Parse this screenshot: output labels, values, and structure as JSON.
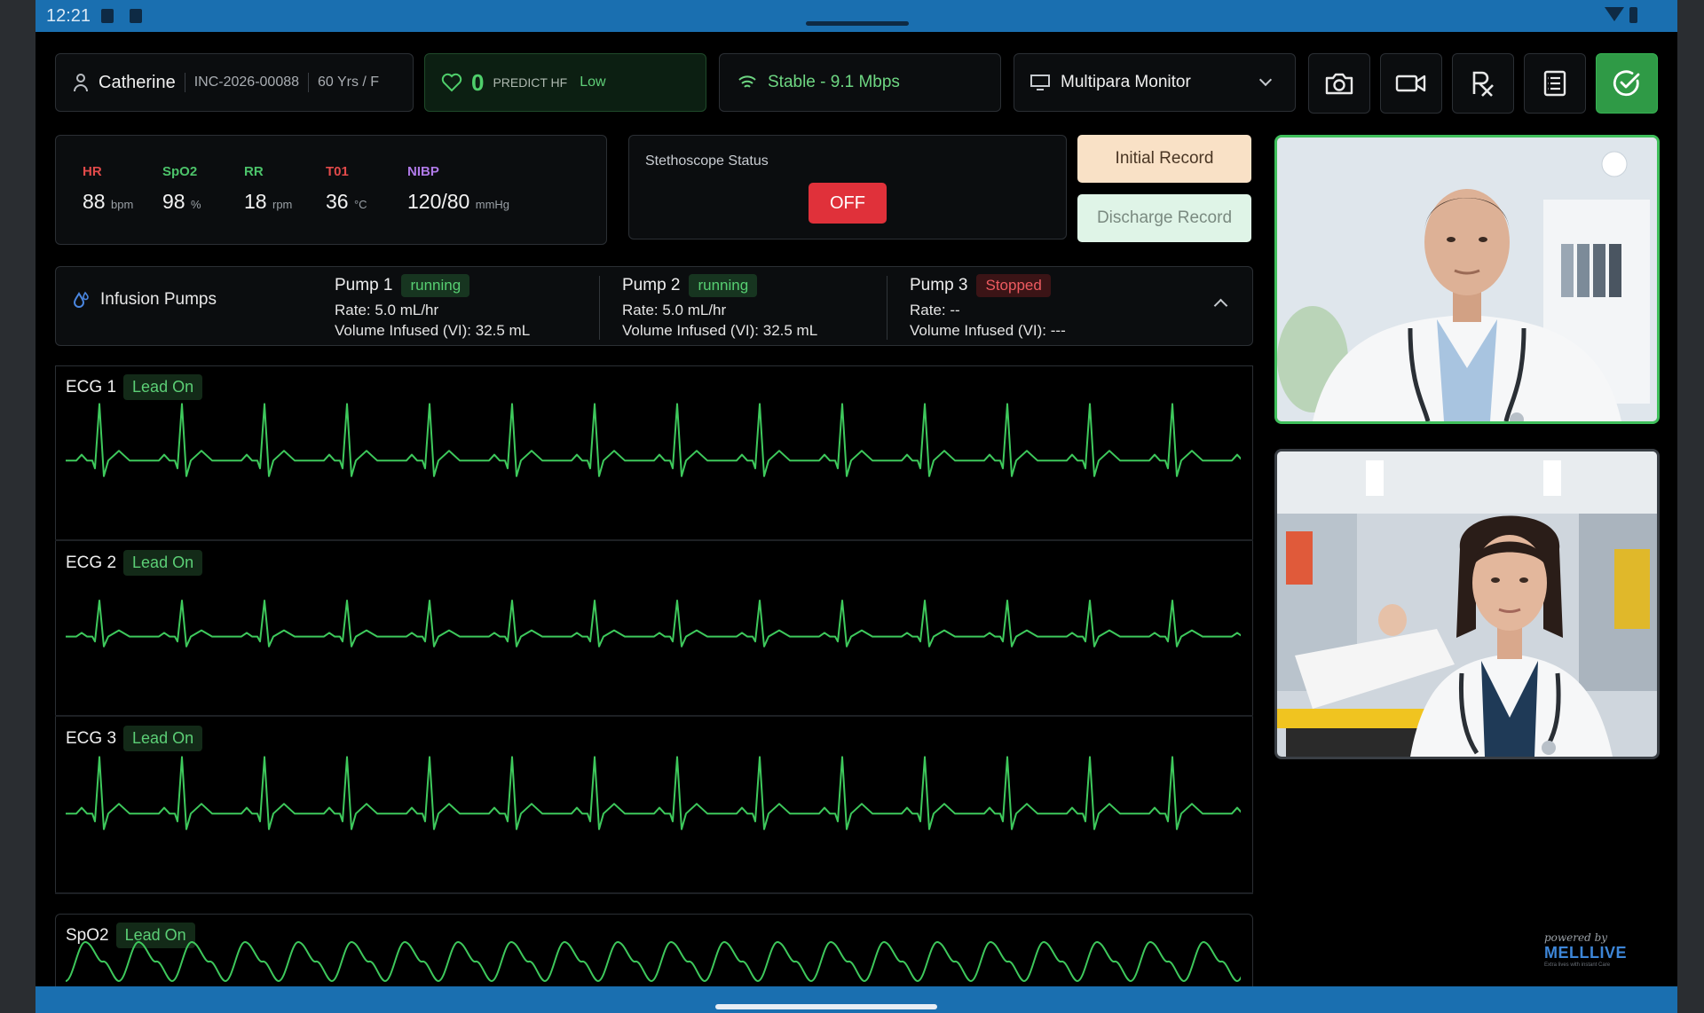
{
  "status_bar": {
    "time": "12:21"
  },
  "patient": {
    "name": "Catherine",
    "incident_id": "INC-2026-00088",
    "age_sex": "60 Yrs / F"
  },
  "predict": {
    "score": "0",
    "label": "PREDICT HF",
    "level": "Low"
  },
  "network": {
    "status": "Stable - 9.1 Mbps",
    "icon": "wifi-icon"
  },
  "monitor_select": {
    "selected": "Multipara Monitor"
  },
  "toolbar": {
    "buttons": [
      "camera-icon",
      "video-icon",
      "prescription-icon",
      "notes-icon",
      "check-circle-icon"
    ]
  },
  "vitals": [
    {
      "label": "HR",
      "value": "88",
      "unit": "bpm",
      "color": "#e24a4a"
    },
    {
      "label": "SpO2",
      "value": "98",
      "unit": "%",
      "color": "#4cc36a"
    },
    {
      "label": "RR",
      "value": "18",
      "unit": "rpm",
      "color": "#4cc36a"
    },
    {
      "label": "T01",
      "value": "36",
      "unit": "°C",
      "color": "#e24a4a"
    },
    {
      "label": "NIBP",
      "value": "120/80",
      "unit": "mmHg",
      "color": "#b07ae8"
    }
  ],
  "stethoscope": {
    "title": "Stethoscope Status",
    "state": "OFF"
  },
  "records": {
    "initial": "Initial Record",
    "discharge": "Discharge Record"
  },
  "infusion": {
    "title": "Infusion Pumps",
    "pumps": [
      {
        "name": "Pump 1",
        "status": "running",
        "rate": "Rate: 5.0 mL/hr",
        "volume": "Volume Infused (VI): 32.5 mL"
      },
      {
        "name": "Pump 2",
        "status": "running",
        "rate": "Rate: 5.0 mL/hr",
        "volume": "Volume Infused (VI): 32.5 mL"
      },
      {
        "name": "Pump 3",
        "status": "Stopped",
        "rate": "Rate: --",
        "volume": "Volume Infused (VI): ---"
      }
    ]
  },
  "waveforms": [
    {
      "name": "ECG 1",
      "lead": "Lead On"
    },
    {
      "name": "ECG 2",
      "lead": "Lead On"
    },
    {
      "name": "ECG 3",
      "lead": "Lead On"
    },
    {
      "name": "SpO2",
      "lead": "Lead On"
    }
  ],
  "branding": {
    "powered": "powered by",
    "brand": "MELLLIVE",
    "tagline": "Extra lives with instant Care"
  },
  "colors": {
    "accent_green": "#3fbf5b",
    "waveform": "#3ec95c",
    "alert_red": "#e0313a",
    "status_blue": "#1a6fb0"
  }
}
